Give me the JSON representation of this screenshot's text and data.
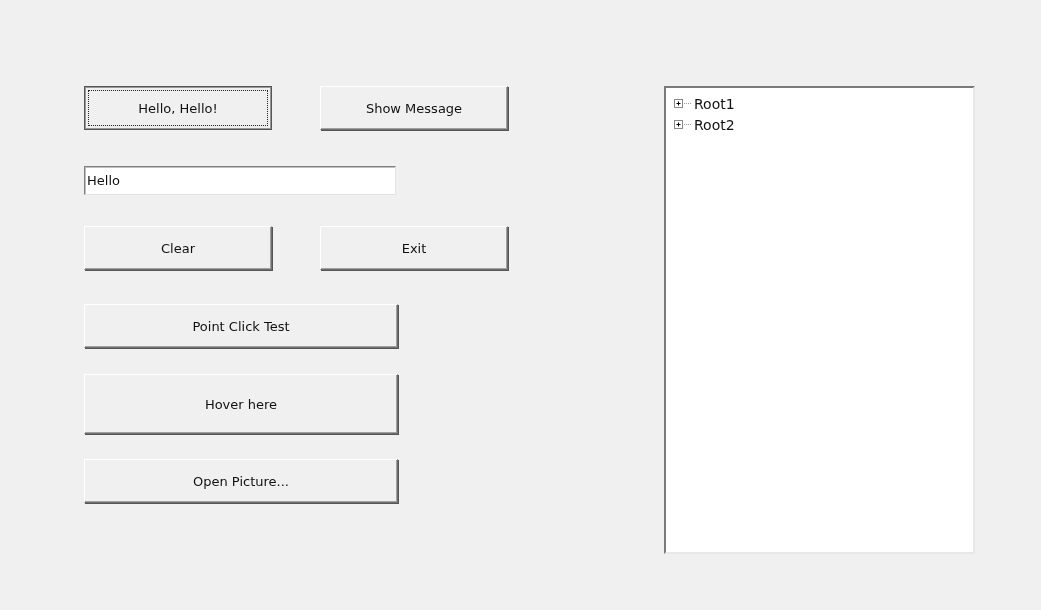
{
  "rows": [
    {
      "kind": "buttons",
      "buttons": [
        {
          "label": "Hello, Hello!",
          "focused": true
        },
        {
          "label": "Show Message",
          "focused": false
        }
      ]
    },
    {
      "kind": "field",
      "value": "Hello"
    },
    {
      "kind": "buttons",
      "buttons": [
        {
          "label": "Clear",
          "focused": false
        },
        {
          "label": "Exit",
          "focused": false
        }
      ]
    },
    {
      "kind": "buttons",
      "buttons": [
        {
          "label": "Point Click Test",
          "focused": false
        }
      ]
    },
    {
      "kind": "buttons",
      "buttons": [
        {
          "label": "Hover here",
          "focused": false
        }
      ]
    },
    {
      "kind": "buttons",
      "buttons": [
        {
          "label": "Open Picture...",
          "focused": false
        }
      ]
    }
  ],
  "tree": [
    {
      "label": "Root1",
      "expanded": false
    },
    {
      "label": "Root2",
      "expanded": false
    }
  ]
}
